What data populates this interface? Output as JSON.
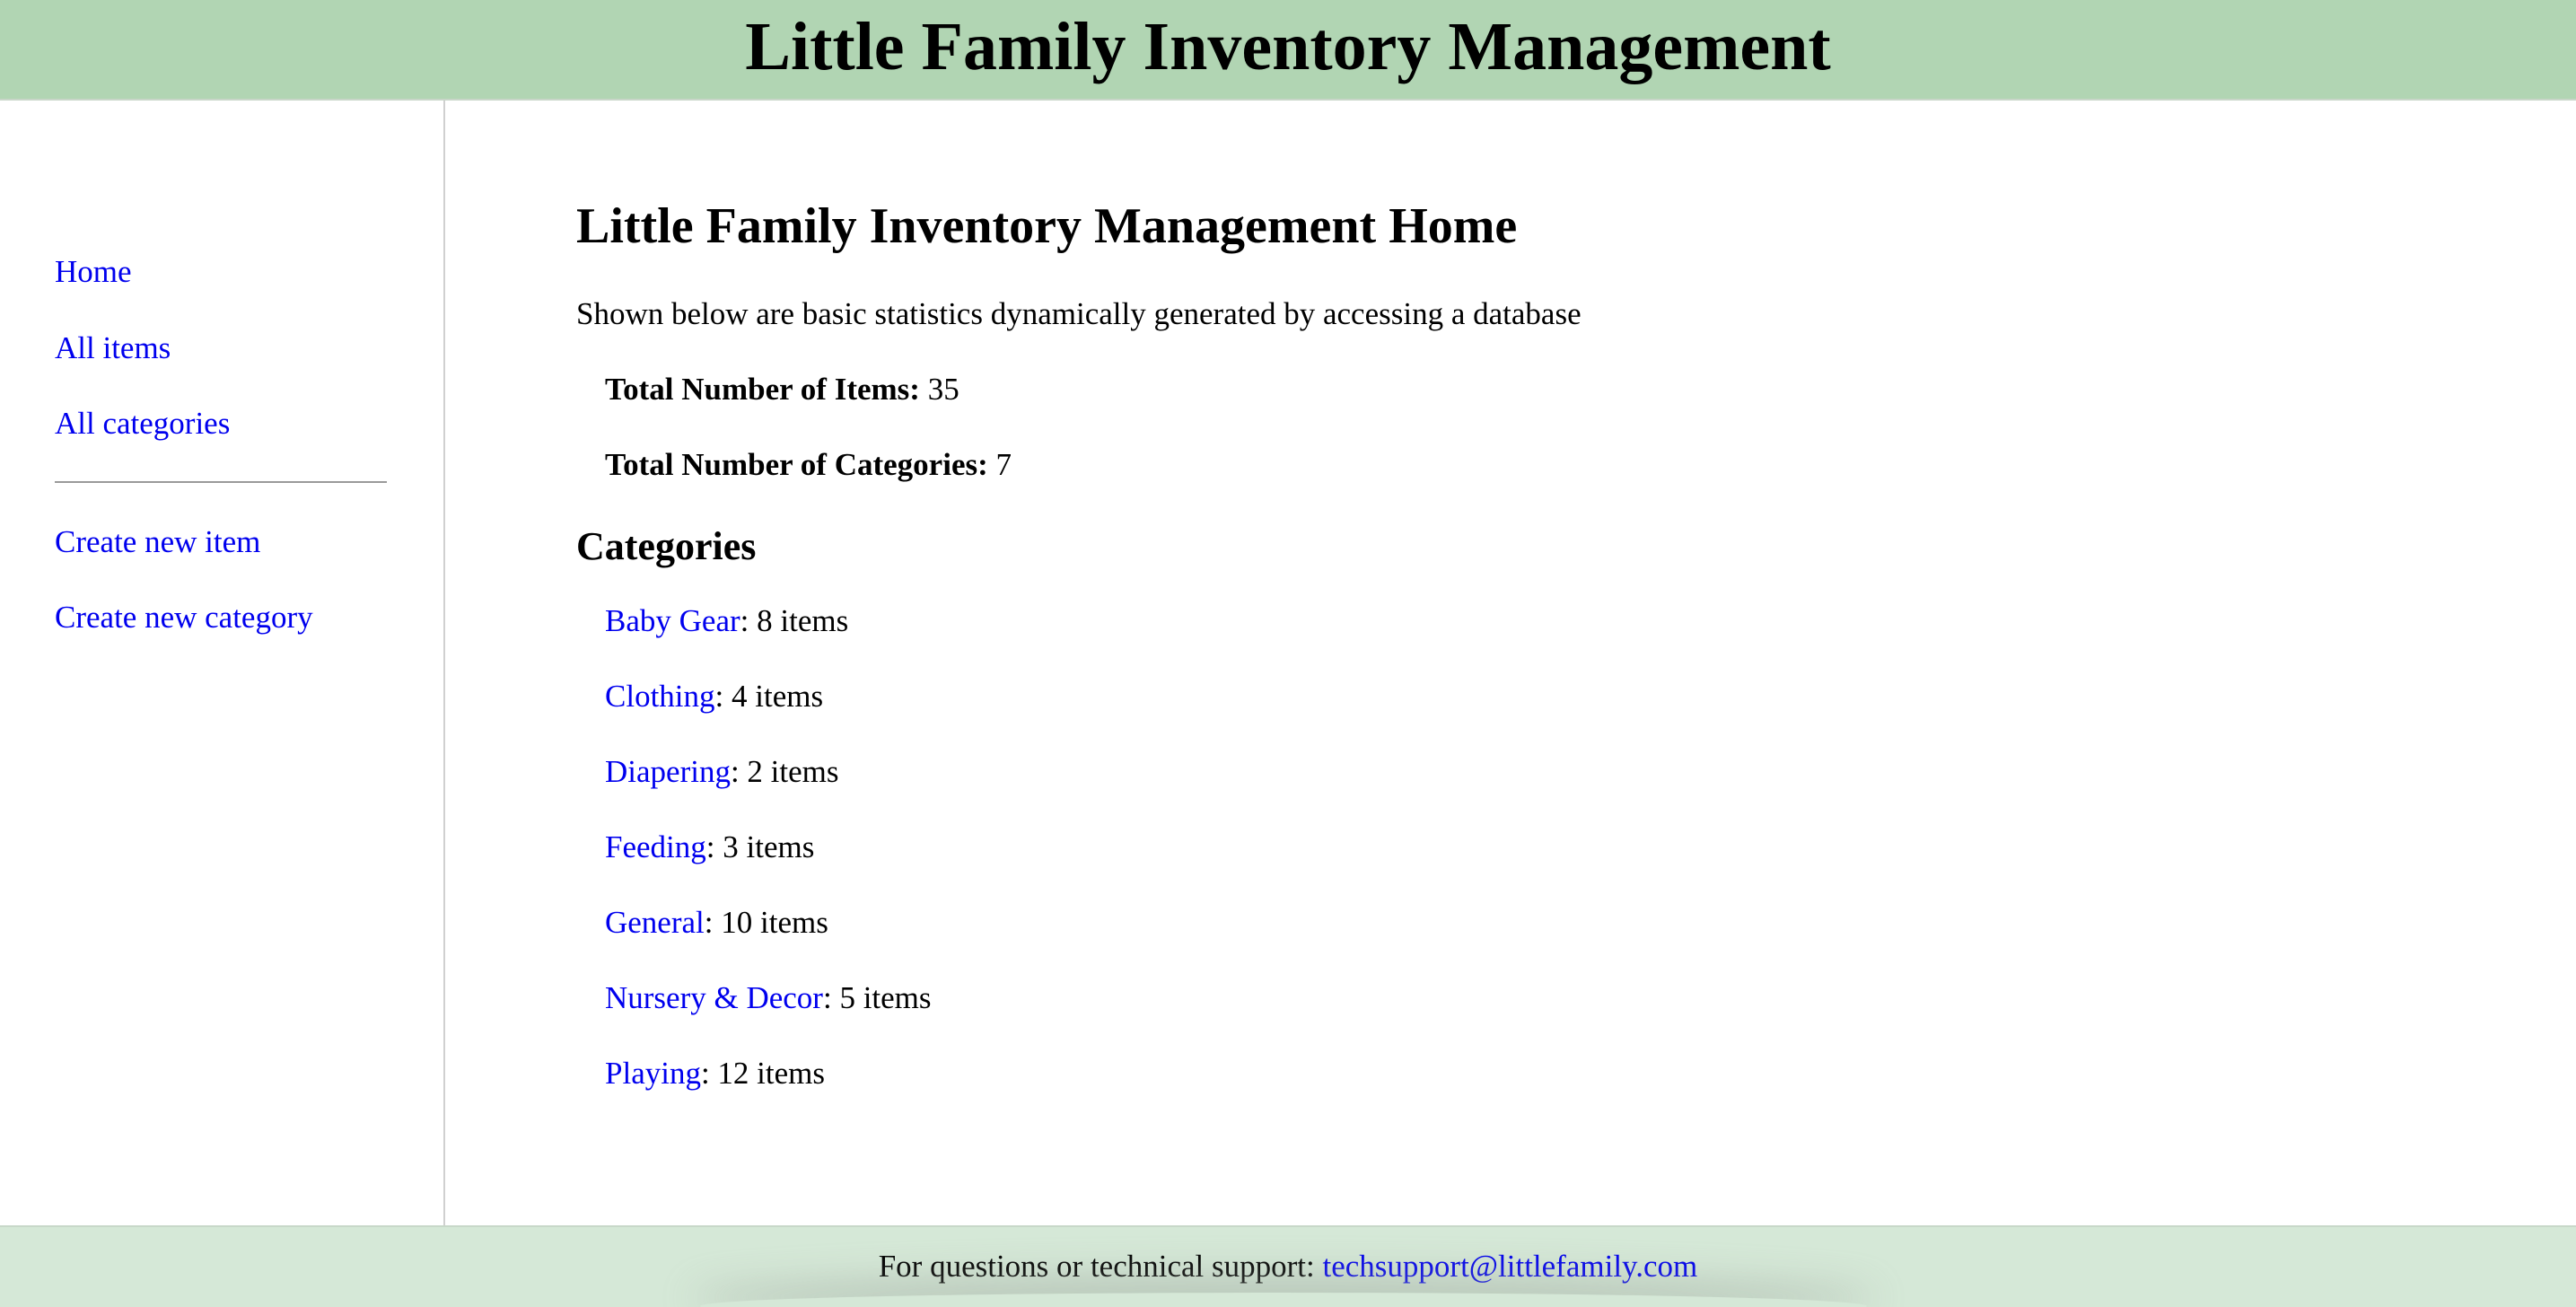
{
  "header": {
    "title": "Little Family Inventory Management"
  },
  "sidebar": {
    "items": [
      {
        "label": "Home"
      },
      {
        "label": "All items"
      },
      {
        "label": "All categories"
      },
      {
        "label": "Create new item"
      },
      {
        "label": "Create new category"
      }
    ]
  },
  "main": {
    "title": "Little Family Inventory Management Home",
    "intro": "Shown below are basic statistics dynamically generated by accessing a database",
    "stats": [
      {
        "label": "Total Number of Items:",
        "value": "35"
      },
      {
        "label": "Total Number of Categories:",
        "value": "7"
      }
    ],
    "categories_heading": "Categories",
    "categories": [
      {
        "name": "Baby Gear",
        "count": ": 8 items"
      },
      {
        "name": "Clothing",
        "count": ": 4 items"
      },
      {
        "name": "Diapering",
        "count": ": 2 items"
      },
      {
        "name": "Feeding",
        "count": ": 3 items"
      },
      {
        "name": "General",
        "count": ": 10 items"
      },
      {
        "name": "Nursery & Decor",
        "count": ": 5 items"
      },
      {
        "name": "Playing",
        "count": ": 12 items"
      }
    ]
  },
  "footer": {
    "text": "For questions or technical support: ",
    "email": "techsupport@littlefamily.com"
  },
  "colors": {
    "header_bg": "#b1d5b3",
    "footer_bg": "#d5e8d7",
    "link": "#0000ee"
  }
}
